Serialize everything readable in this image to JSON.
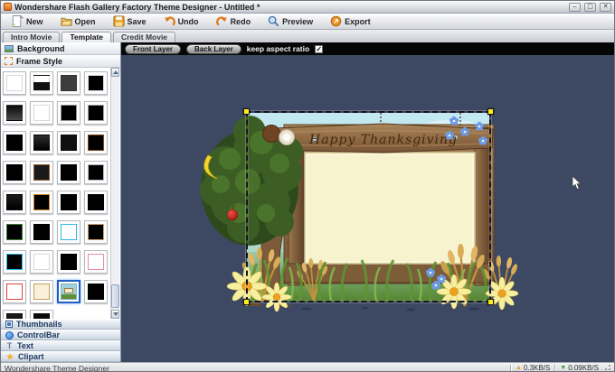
{
  "window": {
    "title": "Wondershare Flash Gallery Factory Theme Designer - Untitled *"
  },
  "toolbar": {
    "buttons": [
      {
        "label": "New"
      },
      {
        "label": "Open"
      },
      {
        "label": "Save"
      },
      {
        "label": "Undo"
      },
      {
        "label": "Redo"
      },
      {
        "label": "Preview"
      },
      {
        "label": "Export"
      }
    ]
  },
  "tabs": [
    {
      "label": "Intro Movie",
      "active": false
    },
    {
      "label": "Template",
      "active": true
    },
    {
      "label": "Credit Movie",
      "active": false
    }
  ],
  "sidebar": {
    "sections": [
      {
        "label": "Background"
      },
      {
        "label": "Frame Style"
      }
    ],
    "accordion": [
      "Thumbnails",
      "ControlBar",
      "Text",
      "Clipart"
    ],
    "frame_styles": [
      {
        "bg": "#ffffff"
      },
      {
        "bg": "linear-gradient(#ffffff 45%,#111111 45%)"
      },
      {
        "bg": "#3d3d3d"
      },
      {
        "bg": "#000000",
        "border": "#d8d8d8"
      },
      {
        "bg": "linear-gradient(#0a0a0a,#4a4a4a)"
      },
      {
        "bg": "#ffffff"
      },
      {
        "bg": "#000000",
        "border": "#909090"
      },
      {
        "bg": "#000000",
        "border": "#a0a0a0"
      },
      {
        "bg": "#000000"
      },
      {
        "bg": "linear-gradient(#2e2e2e,#000000)"
      },
      {
        "bg": "#101010"
      },
      {
        "bg": "#000000",
        "border": "#7a4a20"
      },
      {
        "bg": "#000000"
      },
      {
        "bg": "#1a1a1a",
        "border": "#8a5a30"
      },
      {
        "bg": "#000000"
      },
      {
        "bg": "#000000",
        "border": "#b8b8b8"
      },
      {
        "bg": "linear-gradient(#1a1a1a,#000000)"
      },
      {
        "bg": "#000000",
        "border": "#d08030"
      },
      {
        "bg": "#000000"
      },
      {
        "bg": "#000000"
      },
      {
        "bg": "#000000",
        "border": "#3a7a30"
      },
      {
        "bg": "#000000"
      },
      {
        "bg": "#ffffff",
        "border": "#30b8e8"
      },
      {
        "bg": "#000000",
        "border": "#c8a060"
      },
      {
        "bg": "#000000",
        "border": "#28b8e8"
      },
      {
        "bg": "#ffffff"
      },
      {
        "bg": "#000000"
      },
      {
        "bg": "#ffffff",
        "border": "#e890a0"
      },
      {
        "bg": "#ffffff",
        "border": "#e04040"
      },
      {
        "bg": "#f8f0d8",
        "border": "#c8a060"
      },
      {
        "theme": true,
        "selected": true
      },
      {
        "bg": "#000000"
      },
      {
        "bg": "linear-gradient(#1c1c1c,#000000)"
      },
      {
        "bg": "#0a0a0a"
      }
    ]
  },
  "layer_bar": {
    "front_label": "Front Layer",
    "back_label": "Back Layer",
    "keep_aspect_label": "keep aspect ratio",
    "keep_aspect_checked": true
  },
  "canvas": {
    "sign_text": "Happy Thanksgiving"
  },
  "status_bar": {
    "app_name": "Wondershare Theme Designer",
    "upload_speed": "0.3KB/S",
    "download_speed": "0.09KB/S"
  },
  "colors": {
    "canvas_background": "#3d4963",
    "selection_handle": "#ffec18",
    "sign_wood": "#95704a",
    "board_cream": "#f7f3cf",
    "layer_bar": "#060606"
  }
}
